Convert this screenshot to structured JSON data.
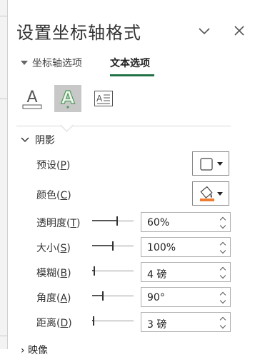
{
  "panel": {
    "title": "设置坐标轴格式",
    "header_icons": [
      "chevron-down-icon",
      "close-icon"
    ]
  },
  "tabs": {
    "axis_options": "坐标轴选项",
    "text_options": "文本选项",
    "active": "text_options",
    "accent_color": "#217346"
  },
  "icon_tabs": [
    "text-fill-icon",
    "text-outline-icon",
    "text-effects-icon"
  ],
  "section": {
    "title": "阴影",
    "expanded": true,
    "preset": {
      "label_main": "预设",
      "key": "P",
      "icon": "shadow-preset-icon"
    },
    "color": {
      "label_main": "颜色",
      "key": "C",
      "icon": "paint-bucket-icon",
      "swatch_color": "#ed7d31"
    },
    "transparency": {
      "label_main": "透明度",
      "key": "T",
      "value": "60%",
      "slider_fraction": 0.6
    },
    "size": {
      "label_main": "大小",
      "key": "S",
      "value": "100%",
      "slider_fraction": 0.5
    },
    "blur": {
      "label_main": "模糊",
      "key": "B",
      "value": "4 磅",
      "slider_fraction": 0.04
    },
    "angle": {
      "label_main": "角度",
      "key": "A",
      "value": "90°",
      "slider_fraction": 0.25
    },
    "distance": {
      "label_main": "距离",
      "key": "D",
      "value": "3 磅",
      "slider_fraction": 0.02
    }
  },
  "next_section": {
    "title": "映像"
  }
}
